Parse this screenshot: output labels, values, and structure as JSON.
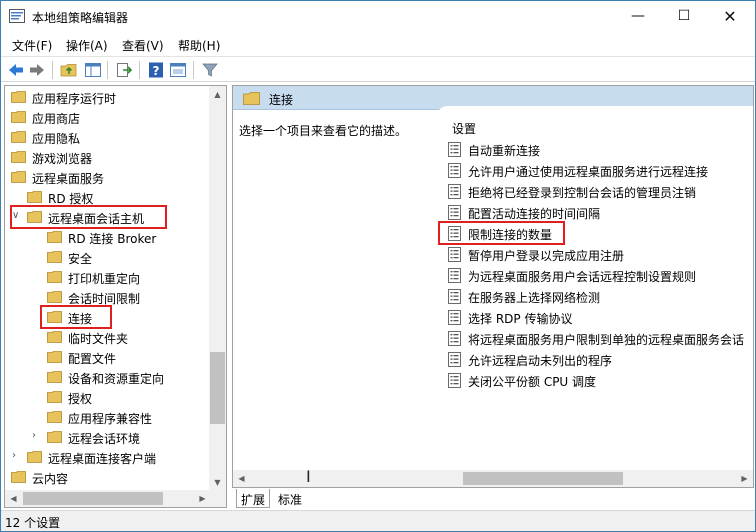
{
  "window": {
    "title": "本地组策略编辑器",
    "controls": {
      "minimize": "—",
      "maximize": "☐",
      "close": "✕"
    }
  },
  "menu": [
    "文件(F)",
    "操作(A)",
    "查看(V)",
    "帮助(H)"
  ],
  "toolbar": {
    "icons": [
      "back-arrow-icon",
      "forward-arrow-icon",
      "up-folder-icon",
      "show-hide-tree-icon",
      "export-list-icon",
      "help-icon",
      "properties-pane-icon",
      "filter-icon"
    ]
  },
  "tree": {
    "items": [
      {
        "label": "应用程序运行时",
        "indent": 0,
        "expander": ""
      },
      {
        "label": "应用商店",
        "indent": 0,
        "expander": ""
      },
      {
        "label": "应用隐私",
        "indent": 0,
        "expander": ""
      },
      {
        "label": "游戏浏览器",
        "indent": 0,
        "expander": ""
      },
      {
        "label": "远程桌面服务",
        "indent": 0,
        "expander": ""
      },
      {
        "label": "RD 授权",
        "indent": 1,
        "expander": ""
      },
      {
        "label": "远程桌面会话主机",
        "indent": 1,
        "expander": "∨"
      },
      {
        "label": "RD 连接 Broker",
        "indent": 2,
        "expander": ""
      },
      {
        "label": "安全",
        "indent": 2,
        "expander": ""
      },
      {
        "label": "打印机重定向",
        "indent": 2,
        "expander": ""
      },
      {
        "label": "会话时间限制",
        "indent": 2,
        "expander": ""
      },
      {
        "label": "连接",
        "indent": 2,
        "expander": ""
      },
      {
        "label": "临时文件夹",
        "indent": 2,
        "expander": ""
      },
      {
        "label": "配置文件",
        "indent": 2,
        "expander": ""
      },
      {
        "label": "设备和资源重定向",
        "indent": 2,
        "expander": ""
      },
      {
        "label": "授权",
        "indent": 2,
        "expander": ""
      },
      {
        "label": "应用程序兼容性",
        "indent": 2,
        "expander": ""
      },
      {
        "label": "远程会话环境",
        "indent": 2,
        "expander": "›"
      },
      {
        "label": "远程桌面连接客户端",
        "indent": 1,
        "expander": "›"
      },
      {
        "label": "云内容",
        "indent": 0,
        "expander": ""
      }
    ]
  },
  "right": {
    "header": "连接",
    "description": "选择一个项目来查看它的描述。",
    "settings_title": "设置",
    "settings": [
      "自动重新连接",
      "允许用户通过使用远程桌面服务进行远程连接",
      "拒绝将已经登录到控制台会话的管理员注销",
      "配置活动连接的时间间隔",
      "限制连接的数量",
      "暂停用户登录以完成应用注册",
      "为远程桌面服务用户会话远程控制设置规则",
      "在服务器上选择网络检测",
      "选择 RDP 传输协议",
      "将远程桌面服务用户限制到单独的远程桌面服务会话",
      "允许远程启动未列出的程序",
      "关闭公平份额 CPU 调度"
    ]
  },
  "tabs": [
    "扩展",
    "标准"
  ],
  "status": "12 个设置",
  "colors": {
    "folder": "#e8c25a",
    "header_bg": "#c8dcf0",
    "highlight": "#e02020",
    "border": "#3c7fb1"
  }
}
